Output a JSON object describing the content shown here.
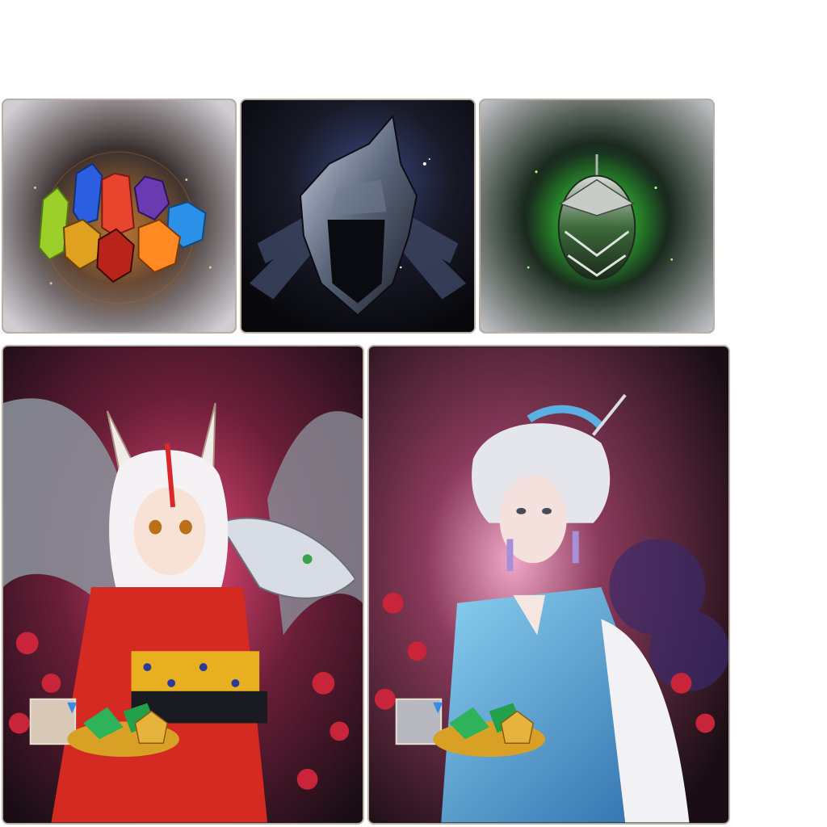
{
  "items": [
    {
      "name": "elemental-gems-bundle",
      "icon": "gems-icon",
      "accent": "#e0802a"
    },
    {
      "name": "dark-knight-helmet",
      "icon": "helmet-icon",
      "accent": "#3a4a78"
    },
    {
      "name": "green-armor-egg",
      "icon": "egg-icon",
      "accent": "#34c93c"
    },
    {
      "name": "fox-kimono-character-bundle",
      "icon": "fox-girl-icon",
      "accent": "#c72a2a"
    },
    {
      "name": "snow-kimono-character-bundle",
      "icon": "kimono-lady-icon",
      "accent": "#3a8fd0"
    }
  ],
  "colors": {
    "frame": "#b9b1a6",
    "frame_glow": "#f3c2a8",
    "card_bg": "#2a282e",
    "plum_blossom": "#c8243a",
    "gold": "#e6b43c",
    "emerald": "#2fb35a"
  }
}
